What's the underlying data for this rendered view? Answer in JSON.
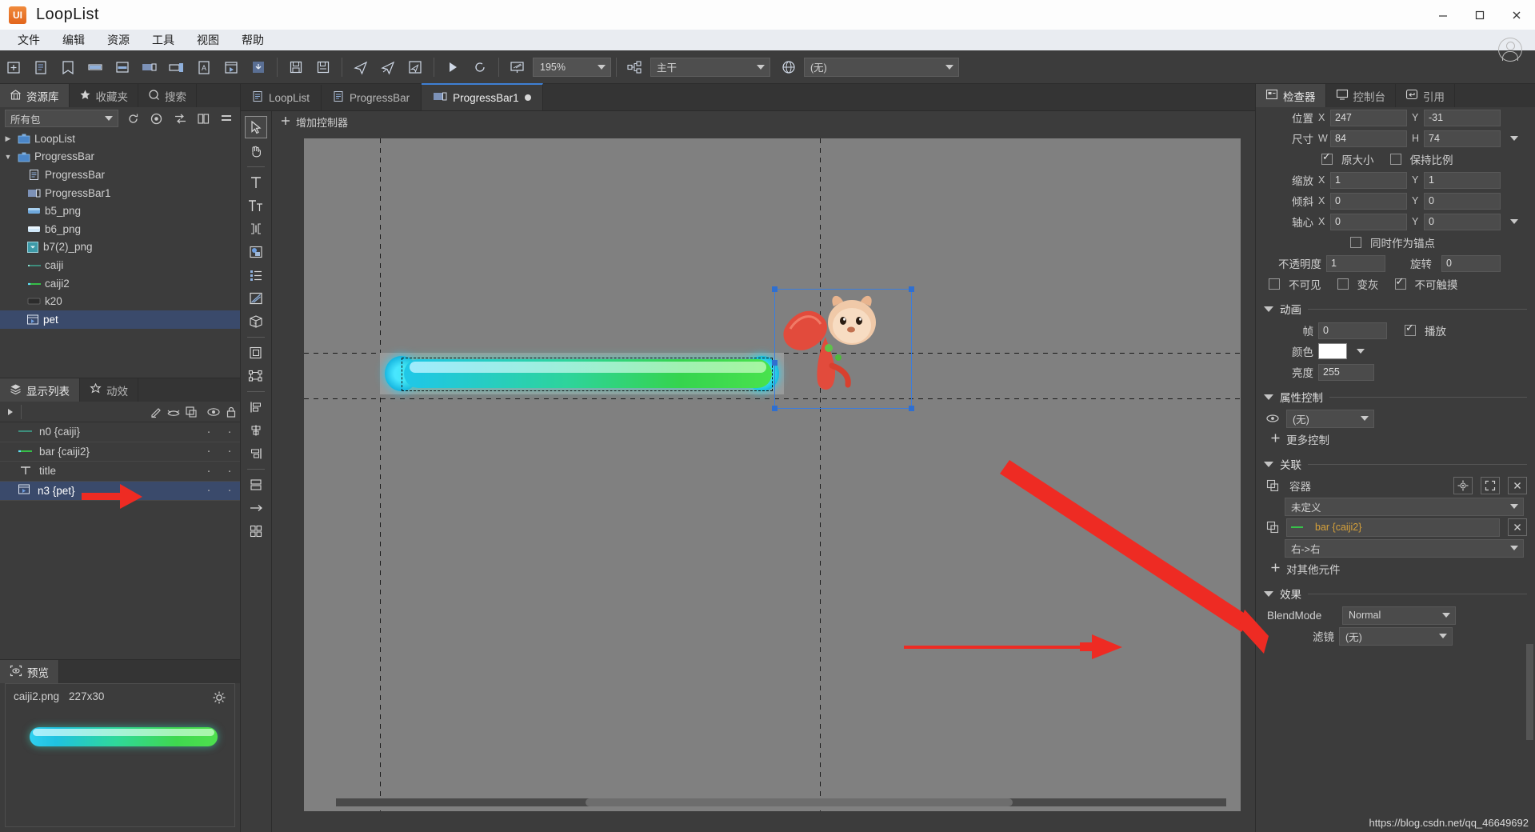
{
  "window": {
    "app_title": "LoopList",
    "logo_text": "UI",
    "minimize": "—",
    "maximize": "▭",
    "close": "✕"
  },
  "menubar": {
    "items": [
      "文件",
      "编辑",
      "资源",
      "工具",
      "视图",
      "帮助"
    ]
  },
  "toolbar": {
    "icons": [
      "new-folder-icon",
      "new-document-icon",
      "bookmark-icon",
      "bar-component-icon",
      "panel-component-icon",
      "filmstrip-icon",
      "toggle-icon",
      "text-asset-icon",
      "movieclip-icon",
      "import-icon",
      "save-icon",
      "save-all-icon",
      "publish-icon",
      "publish-all-icon",
      "publish-settings-icon",
      "play-icon",
      "refresh-icon"
    ],
    "zoom_value": "195%",
    "branch_icon": "branch-icon",
    "branch_value": "主干",
    "locale_icon": "globe-icon",
    "locale_value": "(无)"
  },
  "library": {
    "tabs": [
      {
        "label": "资源库",
        "icon": "library-icon",
        "active": true
      },
      {
        "label": "收藏夹",
        "icon": "star-icon",
        "active": false
      },
      {
        "label": "搜索",
        "icon": "search-icon",
        "active": false
      }
    ],
    "filter_value": "所有包",
    "tool_icons": [
      "refresh-icon",
      "locate-icon",
      "sort-icon",
      "columns-icon",
      "more-icon"
    ],
    "tree": [
      {
        "label": "LoopList",
        "icon": "package-icon",
        "depth": 0,
        "arrow": "▶",
        "selected": false
      },
      {
        "label": "ProgressBar",
        "icon": "package-icon",
        "depth": 0,
        "arrow": "▼",
        "selected": false
      },
      {
        "label": "ProgressBar",
        "icon": "component-icon",
        "depth": 1,
        "arrow": "",
        "selected": false
      },
      {
        "label": "ProgressBar1",
        "icon": "filmstrip-icon",
        "depth": 1,
        "arrow": "",
        "selected": false
      },
      {
        "label": "b5_png",
        "icon": "image-blue-icon",
        "depth": 1,
        "arrow": "",
        "selected": false
      },
      {
        "label": "b6_png",
        "icon": "image-lightblue-icon",
        "depth": 1,
        "arrow": "",
        "selected": false
      },
      {
        "label": "b7(2)_png",
        "icon": "image-teal-icon",
        "depth": 1,
        "arrow": "",
        "selected": false
      },
      {
        "label": "caiji",
        "icon": "line-teal-icon",
        "depth": 1,
        "arrow": "",
        "selected": false
      },
      {
        "label": "caiji2",
        "icon": "line-green-icon",
        "depth": 1,
        "arrow": "",
        "selected": false
      },
      {
        "label": "k20",
        "icon": "image-dark-icon",
        "depth": 1,
        "arrow": "",
        "selected": false
      },
      {
        "label": "pet",
        "icon": "movieclip-icon",
        "depth": 1,
        "arrow": "",
        "selected": true
      }
    ]
  },
  "display_list": {
    "tabs": [
      {
        "label": "显示列表",
        "icon": "layers-icon",
        "active": true
      },
      {
        "label": "动效",
        "icon": "sparkle-icon",
        "active": false
      }
    ],
    "toolbar_icons": [
      "expand-icon",
      "pencil-icon",
      "mask-icon",
      "duplicate-icon",
      "eye-icon",
      "lock-icon"
    ],
    "rows": [
      {
        "label": "n0 {caiji}",
        "icon": "line-teal-icon",
        "selected": false,
        "col1": "·",
        "col2": "·"
      },
      {
        "label": "bar {caiji2}",
        "icon": "line-green-icon",
        "selected": false,
        "col1": "·",
        "col2": "·"
      },
      {
        "label": "title",
        "icon": "text-icon",
        "selected": false,
        "col1": "·",
        "col2": "·"
      },
      {
        "label": "n3 {pet}",
        "icon": "movieclip-icon",
        "selected": true,
        "col1": "·",
        "col2": "·"
      }
    ]
  },
  "preview": {
    "tab_label": "预览",
    "tab_icon": "preview-icon",
    "file_name": "caiji2.png",
    "dimensions": "227x30",
    "settings_icon": "gear-icon"
  },
  "document_tabs": [
    {
      "label": "LoopList",
      "icon": "component-icon",
      "active": false,
      "modified": false
    },
    {
      "label": "ProgressBar",
      "icon": "component-icon",
      "active": false,
      "modified": false
    },
    {
      "label": "ProgressBar1",
      "icon": "filmstrip-icon",
      "active": true,
      "modified": true
    }
  ],
  "canvas": {
    "add_controller_label": "增加控制器",
    "add_controller_icon": "plus-icon",
    "tools": [
      "select-tool-icon",
      "hand-tool-icon",
      "text-tool-icon",
      "rich-text-tool-icon",
      "input-text-tool-icon",
      "loader-tool-icon",
      "list-tool-icon",
      "graph-tool-icon",
      "cube-3d-tool-icon",
      "component-tool-icon",
      "group-tool-icon",
      "align-left-icon",
      "align-center-icon",
      "align-right-icon",
      "distribute-icon",
      "relation-icon",
      "grid-icon"
    ]
  },
  "inspector": {
    "tabs": [
      {
        "label": "检查器",
        "icon": "inspector-icon",
        "active": true
      },
      {
        "label": "控制台",
        "icon": "console-icon",
        "active": false
      },
      {
        "label": "引用",
        "icon": "reference-icon",
        "active": false
      }
    ],
    "position": {
      "label": "位置",
      "x_axis": "X",
      "x": "247",
      "y_axis": "Y",
      "y": "-31"
    },
    "size": {
      "label": "尺寸",
      "w_axis": "W",
      "w": "84",
      "h_axis": "H",
      "h": "74"
    },
    "size_checks": [
      {
        "label": "原大小",
        "checked": true
      },
      {
        "label": "保持比例",
        "checked": false
      }
    ],
    "scale": {
      "label": "缩放",
      "x_axis": "X",
      "x": "1",
      "y_axis": "Y",
      "y": "1"
    },
    "skew": {
      "label": "倾斜",
      "x_axis": "X",
      "x": "0",
      "y_axis": "Y",
      "y": "0"
    },
    "pivot": {
      "label": "轴心",
      "x_axis": "X",
      "x": "0",
      "y_axis": "Y",
      "y": "0"
    },
    "pivot_check": {
      "label": "同时作为锚点",
      "checked": false
    },
    "opacity": {
      "label": "不透明度",
      "value": "1"
    },
    "rotation": {
      "label": "旋转",
      "value": "0"
    },
    "flags": [
      {
        "label": "不可见",
        "checked": false
      },
      {
        "label": "变灰",
        "checked": false
      },
      {
        "label": "不可触摸",
        "checked": true
      }
    ],
    "animation": {
      "section": "动画",
      "frame_label": "帧",
      "frame_value": "0",
      "play_label": "播放",
      "play_checked": true,
      "color_label": "颜色",
      "color_value": "#ffffff",
      "brightness_label": "亮度",
      "brightness_value": "255"
    },
    "property_control": {
      "section": "属性控制",
      "eye_icon": "eye-icon",
      "value": "(无)",
      "add_label": "更多控制",
      "add_icon": "plus-icon"
    },
    "relation": {
      "section": "关联",
      "container_label": "容器",
      "container_icon": "relation-icon",
      "buttons": [
        "target-icon",
        "fullscreen-icon",
        "close-icon"
      ],
      "container_value": "未定义",
      "target_icon": "relation-icon",
      "target_value": "bar {caiji2}",
      "target_color": "#d5a03a",
      "mode_value": "右->右",
      "remove_icon": "close-icon",
      "add_label": "对其他元件",
      "add_icon": "plus-icon"
    },
    "effects": {
      "section": "效果",
      "blend_label": "BlendMode",
      "blend_value": "Normal",
      "filter_label": "滤镜",
      "filter_value": "(无)"
    }
  },
  "watermark": "https://blog.csdn.net/qq_46649692",
  "colors": {
    "accent": "#3e7fd4",
    "selection": "#3a4a6b",
    "panel": "#3c3c3c",
    "annotation": "#ee2b23"
  }
}
